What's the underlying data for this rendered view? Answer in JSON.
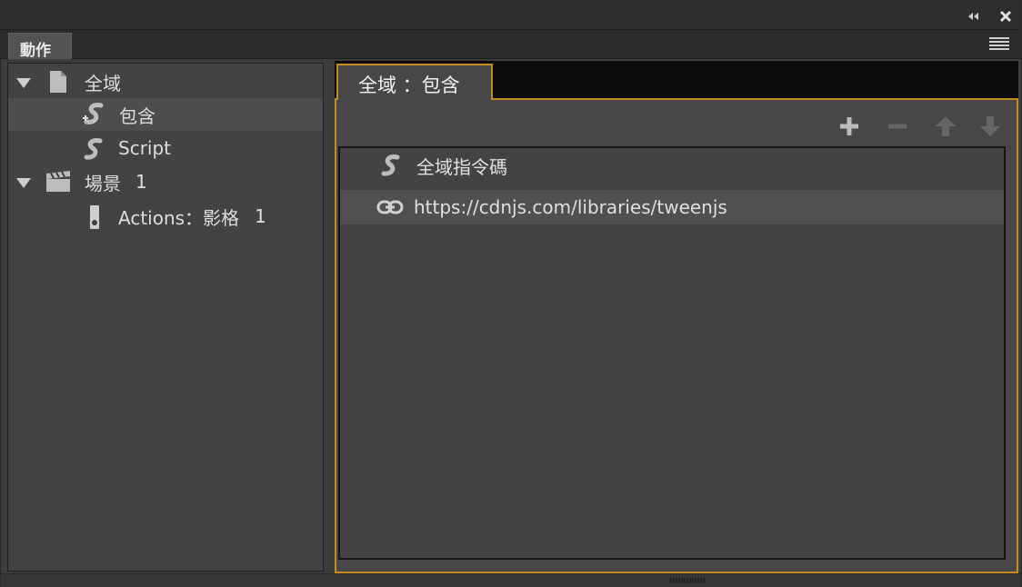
{
  "panel": {
    "tab_label": "動作",
    "titlebar_icons": [
      "collapse-icon",
      "close-icon"
    ],
    "menu_icon": "panel-menu-icon"
  },
  "tree": {
    "items": [
      {
        "label": "全域",
        "icon": "document-icon",
        "expanded": true
      },
      {
        "label": "包含",
        "icon": "include-script-icon",
        "selected": true
      },
      {
        "label": "Script",
        "icon": "script-icon"
      },
      {
        "label": "場景",
        "extra": "1",
        "icon": "scene-clapper-icon",
        "expanded": true
      },
      {
        "label": "Actions：影格",
        "extra": "1",
        "icon": "keyframe-icon"
      }
    ]
  },
  "editor": {
    "tab_label": "全域 ：包含",
    "toolbar": [
      "add-icon",
      "remove-icon",
      "move-up-icon",
      "move-down-icon"
    ],
    "rows": [
      {
        "label": "全域指令碼",
        "icon": "script-icon"
      },
      {
        "label": "https://cdnjs.com/libraries/tweenjs",
        "icon": "link-icon"
      }
    ]
  },
  "colors": {
    "accent": "#c48b1f",
    "panel_bg": "#3c3c3c",
    "tree_bg": "#434343",
    "selection": "#4d4d4d"
  }
}
